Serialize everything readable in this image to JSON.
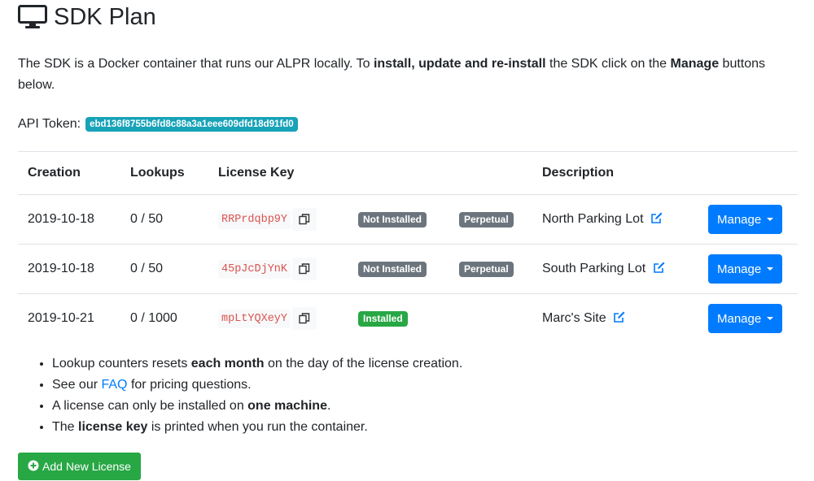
{
  "header": {
    "title": "SDK Plan",
    "icon": "monitor-icon"
  },
  "intro": {
    "part1": "The SDK is a Docker container that runs our ALPR locally. To ",
    "bold1": "install, update and re-install",
    "part2": " the SDK click on the ",
    "bold2": "Manage",
    "part3": " buttons below."
  },
  "api_token": {
    "label": "API Token:",
    "value": "ebd136f8755b6fd8c88a3a1eee609dfd18d91fd0"
  },
  "table": {
    "headers": {
      "creation": "Creation",
      "lookups": "Lookups",
      "license_key": "License Key",
      "description": "Description"
    },
    "rows": [
      {
        "creation": "2019-10-18",
        "lookups": "0 / 50",
        "key": "RRPrdqbp9Y",
        "status": "Not Installed",
        "status_color": "#6c757d",
        "type": "Perpetual",
        "description": "North Parking Lot",
        "action": "Manage"
      },
      {
        "creation": "2019-10-18",
        "lookups": "0 / 50",
        "key": "45pJcDjYnK",
        "status": "Not Installed",
        "status_color": "#6c757d",
        "type": "Perpetual",
        "description": "South Parking Lot",
        "action": "Manage"
      },
      {
        "creation": "2019-10-21",
        "lookups": "0 / 1000",
        "key": "mpLtYQXeyY",
        "status": "Installed",
        "status_color": "#28a745",
        "type": "",
        "description": "Marc's Site",
        "action": "Manage"
      }
    ]
  },
  "notes": {
    "n1a": "Lookup counters resets ",
    "n1b": "each month",
    "n1c": " on the day of the license creation.",
    "n2a": "See our ",
    "n2link": "FAQ",
    "n2c": " for pricing questions.",
    "n3a": "A license can only be installed on ",
    "n3b": "one machine",
    "n3c": ".",
    "n4a": "The ",
    "n4b": "license key",
    "n4c": " is printed when you run the container."
  },
  "add_button": {
    "label": "Add New License",
    "icon": "plus-circle-icon"
  },
  "colors": {
    "primary": "#007bff",
    "success": "#28a745",
    "info": "#17a2b8",
    "secondary": "#6c757d"
  }
}
